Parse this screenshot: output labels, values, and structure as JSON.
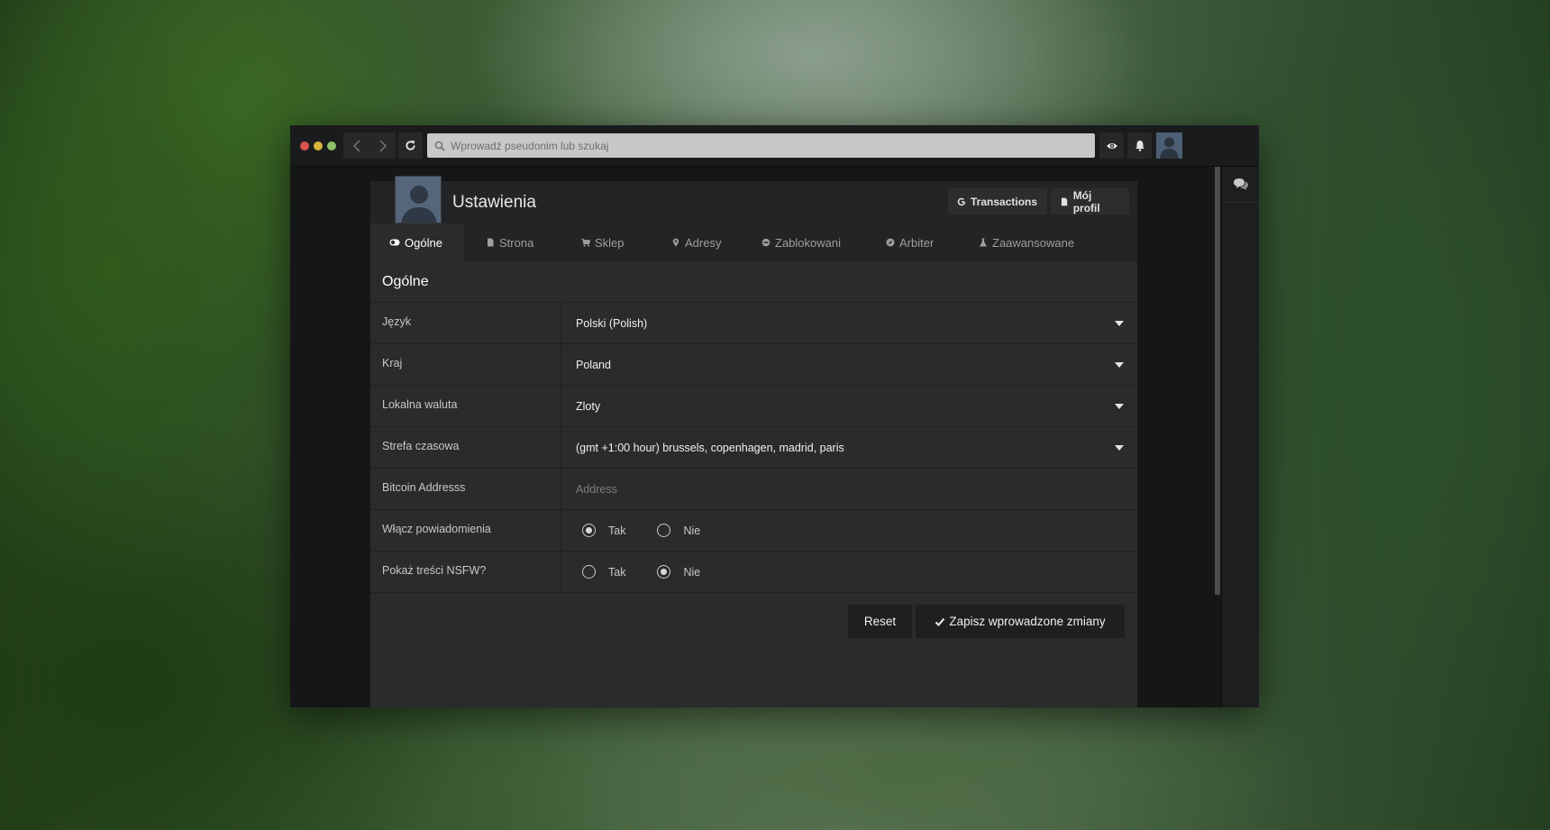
{
  "window": {
    "address_placeholder": "Wprowadź pseudonim lub szukaj"
  },
  "header": {
    "title": "Ustawienia",
    "transactions_label": "Transactions",
    "profile_label": "Mój profil"
  },
  "tabs": [
    {
      "label": "Ogólne",
      "icon": "toggle-icon",
      "active": true
    },
    {
      "label": "Strona",
      "icon": "page-icon",
      "active": false
    },
    {
      "label": "Sklep",
      "icon": "cart-icon",
      "active": false
    },
    {
      "label": "Adresy",
      "icon": "map-pin-icon",
      "active": false
    },
    {
      "label": "Zablokowani",
      "icon": "block-icon",
      "active": false
    },
    {
      "label": "Arbiter",
      "icon": "compass-icon",
      "active": false
    },
    {
      "label": "Zaawansowane",
      "icon": "flask-icon",
      "active": false
    }
  ],
  "section": {
    "title": "Ogólne"
  },
  "fields": {
    "language": {
      "label": "Język",
      "value": "Polski (Polish)"
    },
    "country": {
      "label": "Kraj",
      "value": "Poland"
    },
    "currency": {
      "label": "Lokalna waluta",
      "value": "Zloty"
    },
    "timezone": {
      "label": "Strefa czasowa",
      "value": "(gmt +1:00 hour) brussels, copenhagen, madrid, paris"
    },
    "bitcoin": {
      "label": "Bitcoin Addresss",
      "placeholder": "Address"
    },
    "notifications": {
      "label": "Włącz powiadomienia",
      "yes": "Tak",
      "no": "Nie",
      "selected": "Tak"
    },
    "nsfw": {
      "label": "Pokaż treści NSFW?",
      "yes": "Tak",
      "no": "Nie",
      "selected": "Nie"
    }
  },
  "actions": {
    "reset_label": "Reset",
    "save_label": "Zapisz wprowadzone zmiany"
  }
}
